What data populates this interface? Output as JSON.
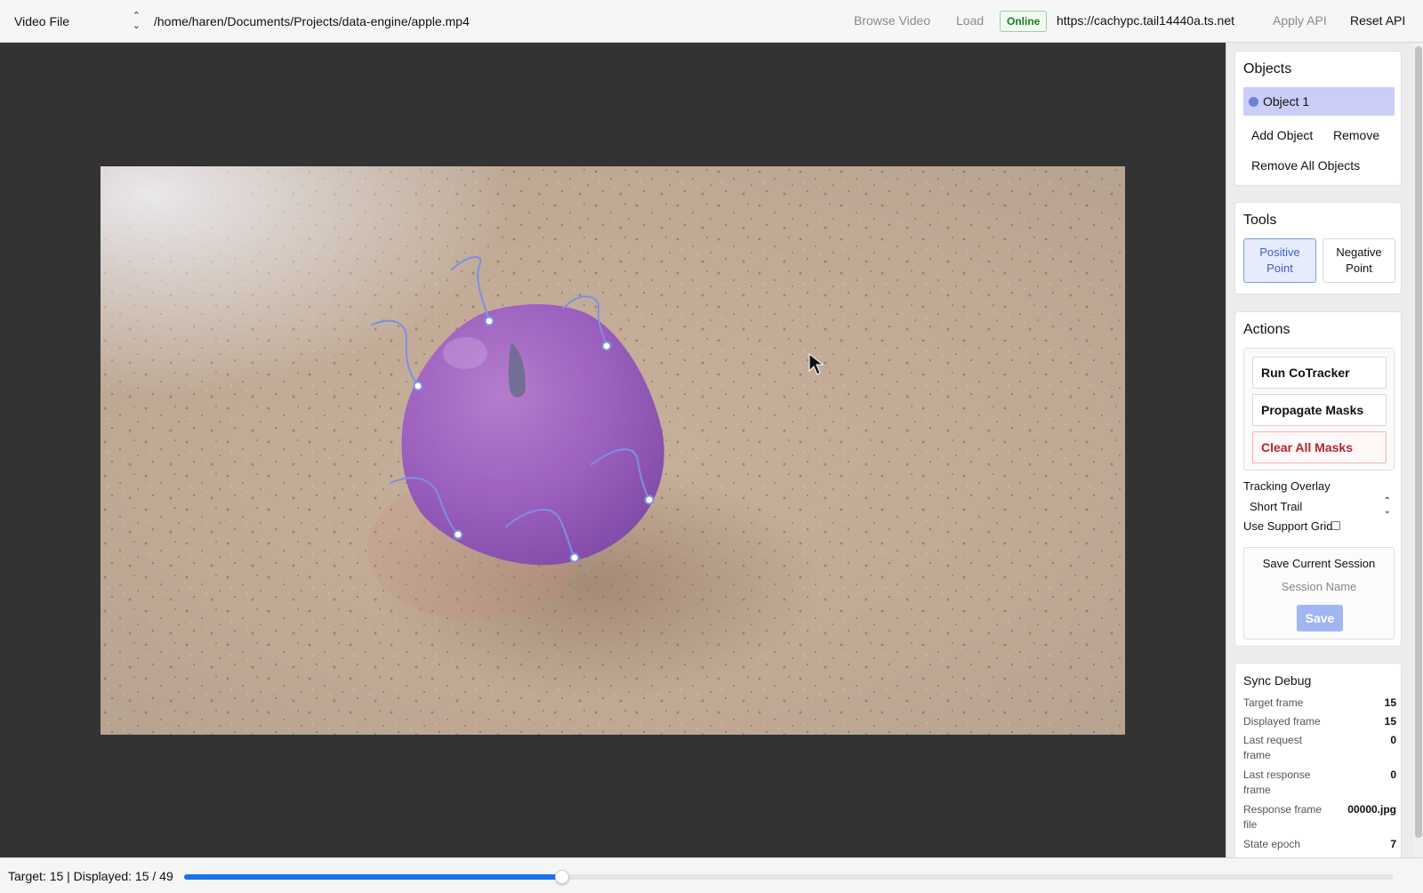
{
  "topbar": {
    "source_type": "Video File",
    "video_path": "/home/haren/Documents/Projects/data-engine/apple.mp4",
    "browse_label": "Browse Video",
    "load_label": "Load",
    "status": "Online",
    "api_url": "https://cachypc.tail14440a.ts.net",
    "apply_api_label": "Apply API",
    "reset_api_label": "Reset API",
    "status_color": "#1d7a24"
  },
  "sidebar": {
    "objects": {
      "title": "Objects",
      "items": [
        {
          "label": "Object 1",
          "color": "#6e7fd8",
          "selected": true
        }
      ],
      "add_label": "Add Object",
      "remove_label": "Remove",
      "remove_all_label": "Remove All Objects"
    },
    "tools": {
      "title": "Tools",
      "positive_line1": "Positive",
      "positive_line2": "Point",
      "negative_line1": "Negative",
      "negative_line2": "Point",
      "active_tool": "positive"
    },
    "actions": {
      "title": "Actions",
      "run_cotracker": "Run CoTracker",
      "propagate_masks": "Propagate Masks",
      "clear_all_masks": "Clear All Masks",
      "tracking_overlay_label": "Tracking Overlay",
      "tracking_overlay_value": "Short Trail",
      "support_grid_label": "Use Support Grid",
      "support_grid_checked": false,
      "save_session_title": "Save Current Session",
      "session_name_placeholder": "Session Name",
      "save_label": "Save"
    },
    "sync_debug": {
      "title": "Sync Debug",
      "rows": [
        {
          "key": "Target frame",
          "value": "15"
        },
        {
          "key": "Displayed frame",
          "value": "15"
        },
        {
          "key": "Last request frame",
          "value": "0"
        },
        {
          "key": "Last response frame",
          "value": "0"
        },
        {
          "key": "Response frame file",
          "value": "00000.jpg"
        },
        {
          "key": "State epoch",
          "value": "7"
        }
      ]
    }
  },
  "footer": {
    "frame_status": "Target: 15 | Displayed: 15 / 49",
    "current_frame": 15,
    "total_frames": 49,
    "accent": "#1a73e8"
  }
}
